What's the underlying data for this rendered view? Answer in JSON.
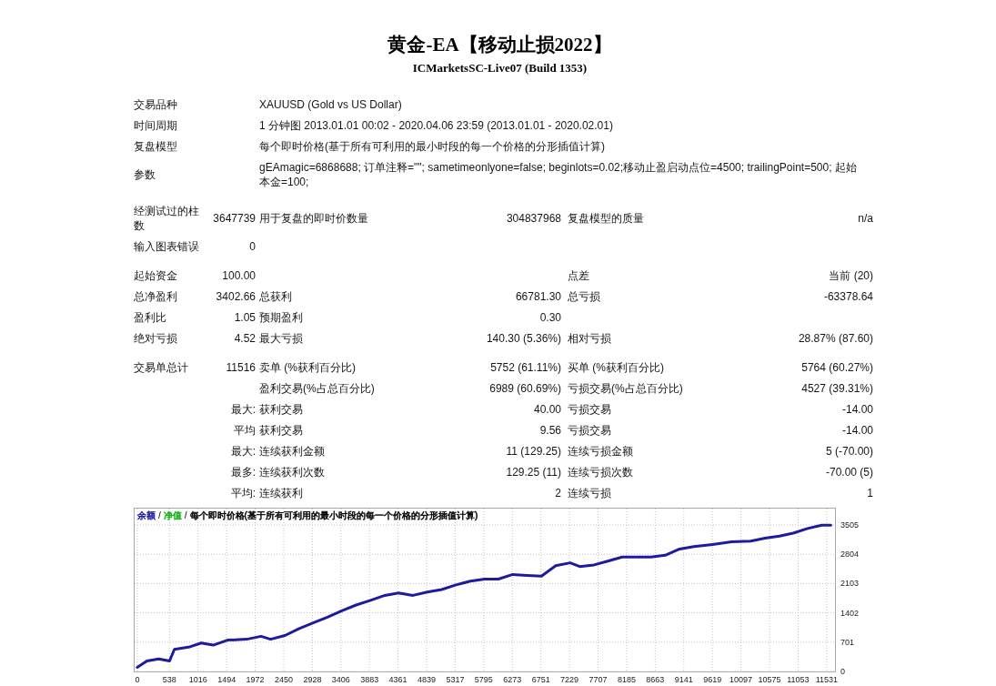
{
  "header": {
    "title": "黄金-EA【移动止损2022】",
    "subtitle": "ICMarketsSC-Live07 (Build 1353)"
  },
  "sections": [
    {
      "rows": [
        {
          "kind": "wide",
          "label": "交易品种",
          "value": "XAUUSD (Gold vs US Dollar)"
        },
        {
          "kind": "wide",
          "label": "时间周期",
          "value": "1 分钟图 2013.01.01 00:02 - 2020.04.06 23:59 (2013.01.01 - 2020.02.01)"
        },
        {
          "kind": "wide",
          "label": "复盘模型",
          "value": "每个即时价格(基于所有可利用的最小时段的每一个价格的分形插值计算)"
        },
        {
          "kind": "wide",
          "label": "参数",
          "value": "gEAmagic=6868688; 订单注释=\"\"; sametimeonlyone=false; beginlots=0.02;移动止盈启动点位=4500; trailingPoint=500; 起始本金=100;"
        }
      ]
    },
    {
      "rows": [
        {
          "kind": "stats",
          "label": "经测试过的柱数",
          "value": "3647739",
          "middle": {
            "label": "用于复盘的即时价数量",
            "value": "304837968"
          },
          "right": {
            "label": "复盘模型的质量",
            "value": "n/a"
          }
        },
        {
          "kind": "stats",
          "label": "输入图表错误",
          "value": "0"
        }
      ]
    },
    {
      "rows": [
        {
          "kind": "stats",
          "label": "起始资金",
          "value": "100.00",
          "right": {
            "label": "点差",
            "value": "当前 (20)"
          }
        },
        {
          "kind": "stats",
          "label": "总净盈利",
          "value": "3402.66",
          "middle": {
            "label": "总获利",
            "value": "66781.30"
          },
          "right": {
            "label": "总亏损",
            "value": "-63378.64"
          }
        },
        {
          "kind": "stats",
          "label": "盈利比",
          "value": "1.05",
          "middle": {
            "label": "预期盈利",
            "value": "0.30"
          }
        },
        {
          "kind": "stats",
          "label": "绝对亏损",
          "value": "4.52",
          "middle": {
            "label": "最大亏损",
            "value": "140.30 (5.36%)"
          },
          "right": {
            "label": "相对亏损",
            "value": "28.87% (87.60)"
          }
        }
      ]
    },
    {
      "rows": [
        {
          "kind": "stats",
          "label": "交易单总计",
          "value": "11516",
          "middle": {
            "label": "卖单 (%获利百分比)",
            "value": "5752 (61.11%)"
          },
          "right": {
            "label": "买单 (%获利百分比)",
            "value": "5764 (60.27%)"
          }
        },
        {
          "kind": "stats",
          "middle": {
            "label": "盈利交易(%占总百分比)",
            "value": "6989 (60.69%)"
          },
          "right": {
            "label": "亏损交易(%占总百分比)",
            "value": "4527 (39.31%)"
          }
        },
        {
          "kind": "stats",
          "qualifier": "最大:",
          "middle": {
            "label": "获利交易",
            "value": "40.00"
          },
          "right": {
            "label": "亏损交易",
            "value": "-14.00"
          }
        },
        {
          "kind": "stats",
          "qualifier": "平均",
          "middle": {
            "label": "获利交易",
            "value": "9.56"
          },
          "right": {
            "label": "亏损交易",
            "value": "-14.00"
          }
        },
        {
          "kind": "stats",
          "qualifier": "最大:",
          "middle": {
            "label": "连续获利金额",
            "value": "11 (129.25)"
          },
          "right": {
            "label": "连续亏损金额",
            "value": "5 (-70.00)"
          }
        },
        {
          "kind": "stats",
          "qualifier": "最多:",
          "middle": {
            "label": "连续获利次数",
            "value": "129.25 (11)"
          },
          "right": {
            "label": "连续亏损次数",
            "value": "-70.00 (5)"
          }
        },
        {
          "kind": "stats",
          "qualifier": "平均:",
          "middle": {
            "label": "连续获利",
            "value": "2"
          },
          "right": {
            "label": "连续亏损",
            "value": "1"
          }
        }
      ]
    }
  ],
  "chart": {
    "legend": [
      {
        "label": "净值",
        "color": "#10b010"
      },
      {
        "label": "每个即时价格(基于所有可利用的最小时段的每一个价格的分形插值计算)",
        "color": "#000000"
      }
    ],
    "legend_separators": [
      "/",
      "/"
    ],
    "chart_data": {
      "type": "line",
      "grid": true,
      "x": [
        0,
        160,
        360,
        540,
        620,
        880,
        1070,
        1270,
        1510,
        1830,
        2070,
        2230,
        2470,
        2700,
        2940,
        3180,
        3420,
        3660,
        3900,
        4140,
        4370,
        4610,
        4850,
        5090,
        5330,
        5570,
        5810,
        6040,
        6280,
        6520,
        6760,
        7000,
        7240,
        7400,
        7640,
        7870,
        8110,
        8350,
        8590,
        8830,
        9070,
        9310,
        9620,
        9940,
        10260,
        10500,
        10740,
        10970,
        11210,
        11450,
        11600
      ],
      "series": [
        {
          "name": "余额",
          "color": "#1c1c9c",
          "values": [
            100,
            250,
            300,
            250,
            530,
            590,
            680,
            630,
            750,
            770,
            840,
            770,
            860,
            1020,
            1160,
            1300,
            1450,
            1590,
            1700,
            1820,
            1880,
            1820,
            1900,
            1960,
            2070,
            2160,
            2210,
            2210,
            2320,
            2300,
            2280,
            2530,
            2600,
            2510,
            2550,
            2640,
            2740,
            2740,
            2740,
            2780,
            2930,
            2990,
            3040,
            3100,
            3120,
            3190,
            3240,
            3310,
            3420,
            3500,
            3500
          ]
        }
      ],
      "xlim": [
        -60,
        11670
      ],
      "ylim": [
        0,
        3919
      ],
      "xticks": [
        0,
        538,
        1016,
        1494,
        1972,
        2450,
        2928,
        3406,
        3883,
        4361,
        4839,
        5317,
        5795,
        6273,
        6751,
        7229,
        7707,
        8185,
        8663,
        9141,
        9619,
        10097,
        10575,
        11053,
        11531
      ],
      "yticks": [
        0,
        701,
        1402,
        2103,
        2804,
        3505
      ]
    }
  }
}
